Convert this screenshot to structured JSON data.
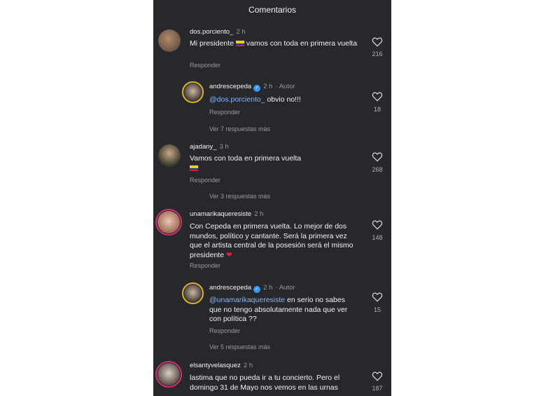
{
  "header": {
    "title": "Comentarios"
  },
  "comments": [
    {
      "user": "dos.porciento_",
      "time": "2 h",
      "text": "Mi presidente",
      "text_after": " vamos con toda en primera vuelta",
      "reply": "Responder",
      "likes": "216"
    },
    {
      "user": "andrescepeda",
      "time": "2 h",
      "autor": "· Autor",
      "mention": "@dos.porciento_",
      "text": " obvio no!!!",
      "reply": "Responder",
      "likes": "18",
      "more": "Ver 7 respuestas más"
    },
    {
      "user": "ajadany_",
      "time": "3 h",
      "text": "Vamos con toda en primera vuelta",
      "reply": "Responder",
      "likes": "268",
      "more": "Ver 3 respuestas más"
    },
    {
      "user": "unamarikaqueresiste",
      "time": "2 h",
      "text": "Con Cepeda en primera vuelta. Lo mejor de dos mundos, político y cantante. Será la primera vez que el artista central de la posesión será el mismo presidente",
      "reply": "Responder",
      "likes": "148"
    },
    {
      "user": "andrescepeda",
      "time": "2 h",
      "autor": "· Autor",
      "mention": "@unamarikaqueresiste",
      "text": " en serio no sabes que no tengo absolutamente nada que ver con política ??",
      "reply": "Responder",
      "likes": "15",
      "more": "Ver 5 respuestas más"
    },
    {
      "user": "elsantyvelasquez",
      "time": "2 h",
      "text": "lastima que no pueda ir a tu concierto. Pero el domingo 31 de Mayo nos vemos en las urnas",
      "likes": "187"
    }
  ],
  "colors": {
    "panel": "#26282b",
    "mention": "#8fb4f5",
    "verified": "#3897f0"
  }
}
